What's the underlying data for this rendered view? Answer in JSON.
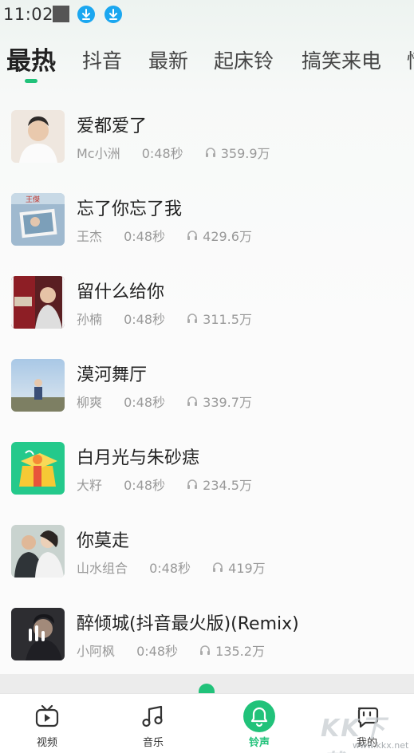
{
  "status_bar": {
    "time": "11:02",
    "icons": [
      "notification-square-icon",
      "download-icon",
      "download-icon"
    ],
    "accent": "#1ba7f0"
  },
  "tabs": [
    {
      "label": "最热",
      "active": true
    },
    {
      "label": "抖音",
      "active": false
    },
    {
      "label": "最新",
      "active": false
    },
    {
      "label": "起床铃",
      "active": false
    },
    {
      "label": "搞笑来电",
      "active": false
    },
    {
      "label": "情",
      "active": false
    }
  ],
  "songs": [
    {
      "title": "爱都爱了",
      "artist": "Mc小洲",
      "duration": "0:48秒",
      "plays": "359.9万"
    },
    {
      "title": "忘了你忘了我",
      "artist": "王杰",
      "duration": "0:48秒",
      "plays": "429.6万"
    },
    {
      "title": "留什么给你",
      "artist": "孙楠",
      "duration": "0:48秒",
      "plays": "311.5万"
    },
    {
      "title": "漠河舞厅",
      "artist": "柳爽",
      "duration": "0:48秒",
      "plays": "339.7万"
    },
    {
      "title": "白月光与朱砂痣",
      "artist": "大籽",
      "duration": "0:48秒",
      "plays": "234.5万"
    },
    {
      "title": "你莫走",
      "artist": "山水组合",
      "duration": "0:48秒",
      "plays": "419万"
    },
    {
      "title": "醉倾城(抖音最火版)(Remix)",
      "artist": "小阿枫",
      "duration": "0:48秒",
      "plays": "135.2万"
    }
  ],
  "bottom_nav": [
    {
      "label": "视频",
      "icon": "video-icon",
      "active": false
    },
    {
      "label": "音乐",
      "icon": "music-note-icon",
      "active": false
    },
    {
      "label": "铃声",
      "icon": "bell-icon",
      "active": true
    },
    {
      "label": "我的",
      "icon": "profile-icon",
      "active": false
    }
  ],
  "watermark": {
    "text": "KK下载",
    "url": "www.kkx.net"
  },
  "colors": {
    "accent": "#21c27a",
    "text_primary": "#222222",
    "text_secondary": "#999999"
  }
}
